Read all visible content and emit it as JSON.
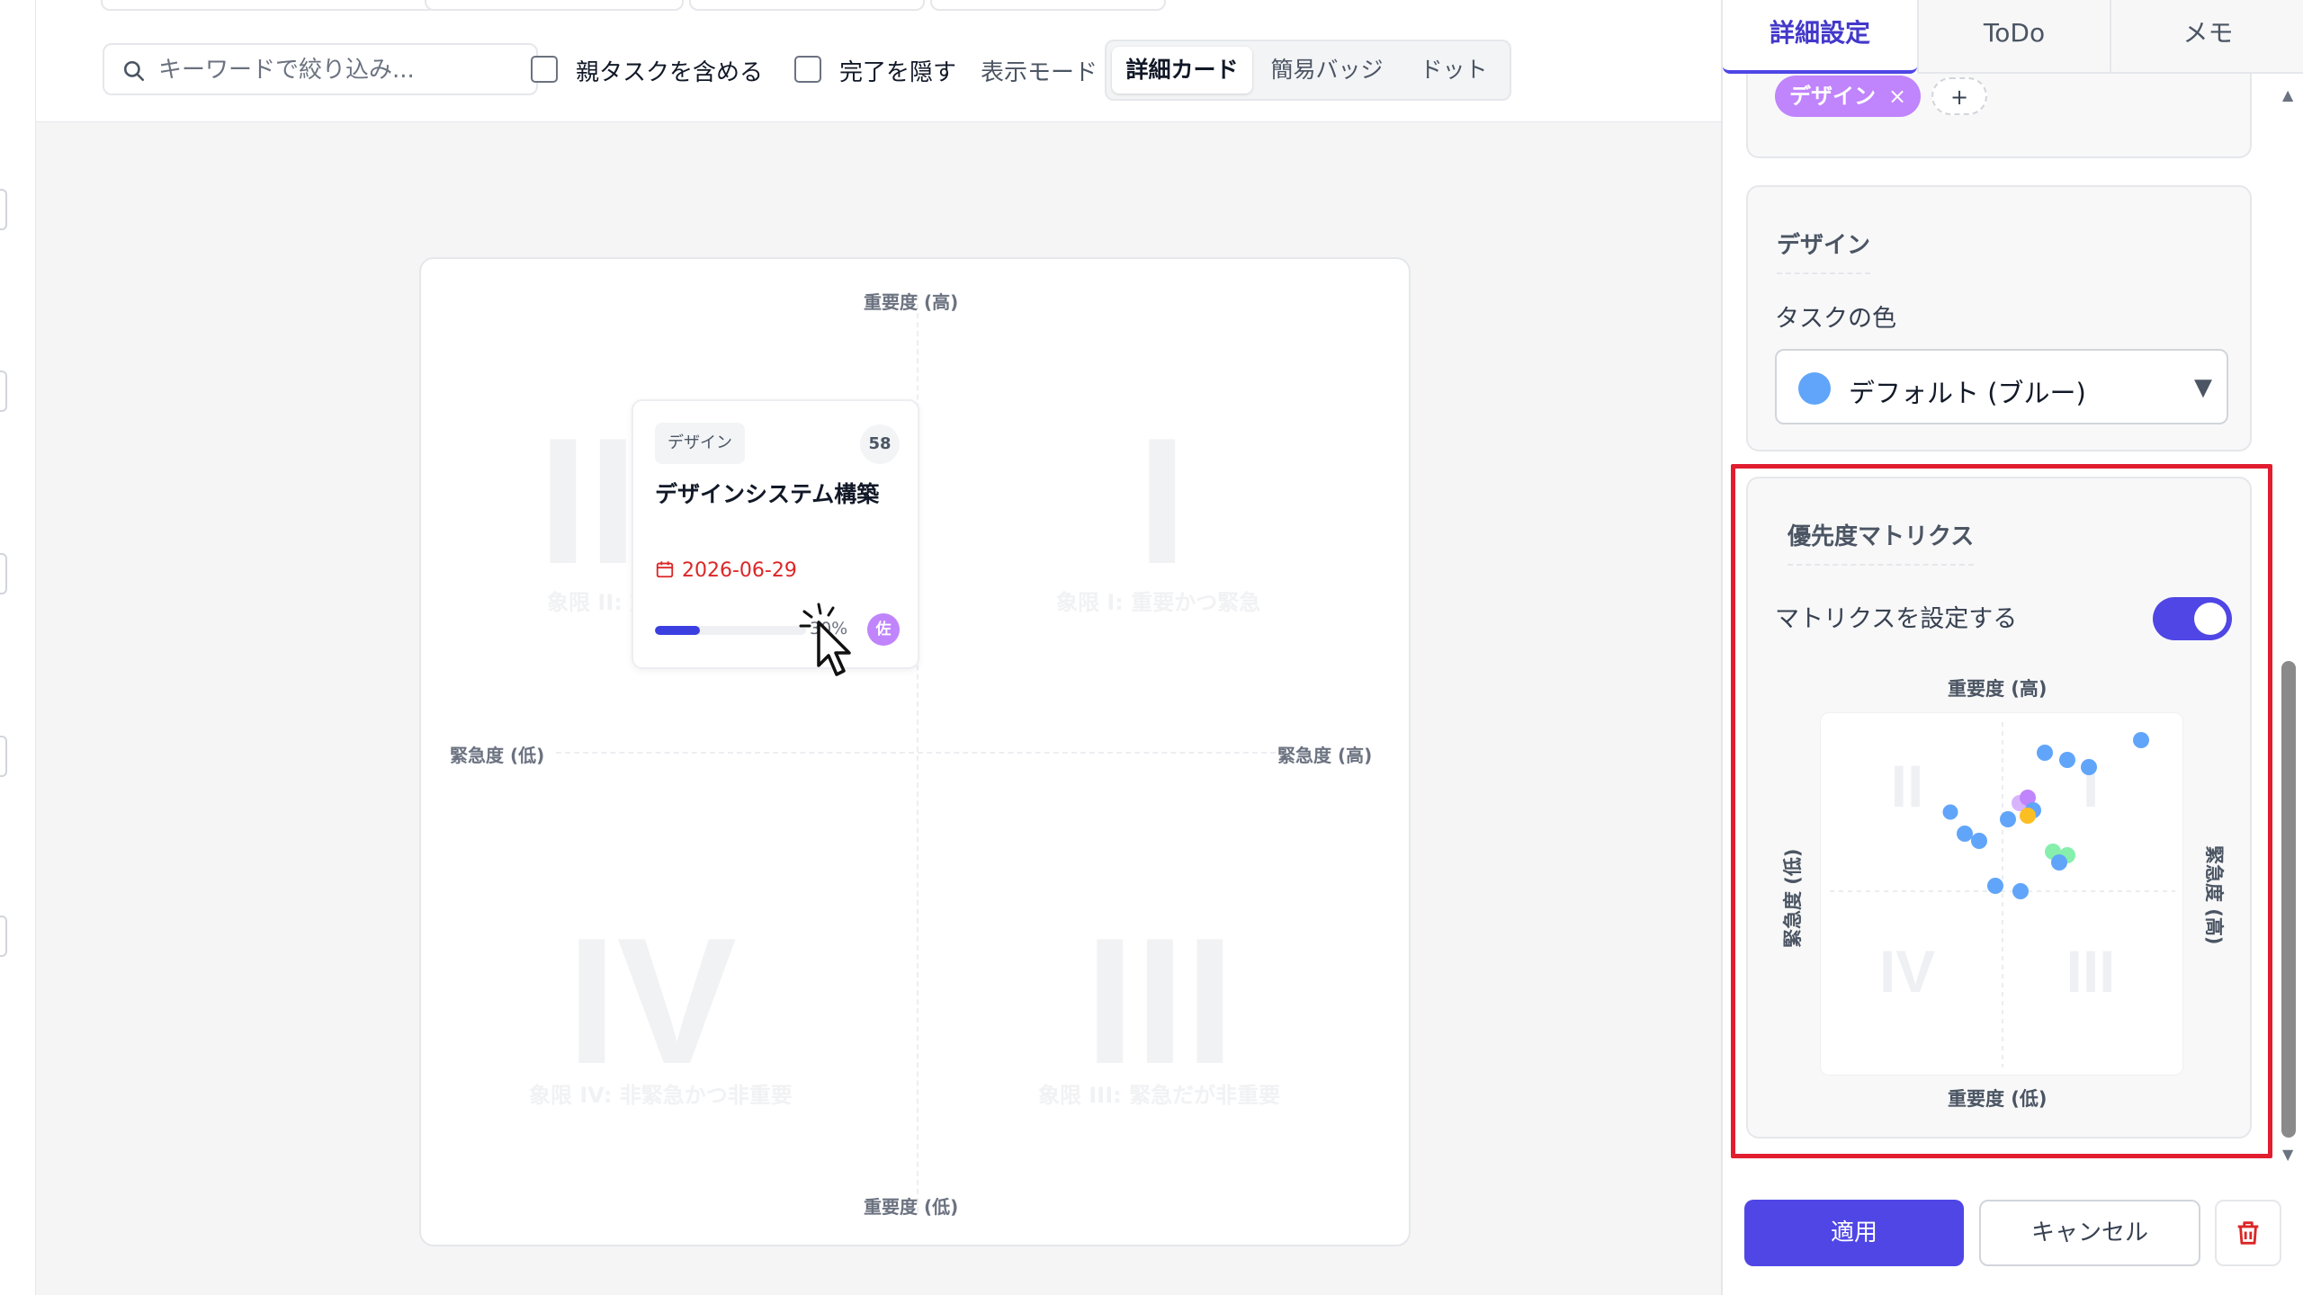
{
  "toolbar": {
    "search_placeholder": "キーワードで絞り込み...",
    "include_parent_label": "親タスクを含める",
    "hide_done_label": "完了を隠す",
    "view_mode_label": "表示モード",
    "view_modes": [
      "詳細カード",
      "簡易バッジ",
      "ドット"
    ],
    "active_view_mode": "詳細カード"
  },
  "matrix": {
    "axis_top": "重要度 (高)",
    "axis_bottom": "重要度 (低)",
    "axis_left": "緊急度 (低)",
    "axis_right": "緊急度 (高)",
    "quadrants": [
      {
        "roman": "I",
        "label": "象限 I: 重要かつ緊急"
      },
      {
        "roman": "II",
        "label": "象限 II: 重要だが非緊急"
      },
      {
        "roman": "III",
        "label": "象限 III: 緊急だが非重要"
      },
      {
        "roman": "IV",
        "label": "象限 IV: 非緊急かつ非重要"
      }
    ]
  },
  "card": {
    "tag": "デザイン",
    "count": "58",
    "title": "デザインシステム構築",
    "due_date": "2026-06-29",
    "progress_text": "30%",
    "progress": 0.3,
    "assignee_initial": "佐"
  },
  "panel": {
    "tabs": [
      "詳細設定",
      "ToDo",
      "メモ"
    ],
    "active_tab": "詳細設定",
    "chip_label": "デザイン",
    "chip_remove": "×",
    "add_chip": "+",
    "color_section_title": "デザイン",
    "task_color_label": "タスクの色",
    "task_color_value": "デフォルト (ブルー)",
    "task_color_swatch": "#60a5fa",
    "matrix_section_title": "優先度マトリクス",
    "matrix_toggle_label": "マトリクスを設定する",
    "matrix_toggle_on": true,
    "mini_axis_top": "重要度 (高)",
    "mini_axis_bottom": "重要度 (低)",
    "mini_axis_left": "緊急度 (低)",
    "mini_axis_right": "緊急度 (高)",
    "mini_quadrants": [
      "II",
      "I",
      "IV",
      "III"
    ],
    "apply_label": "適用",
    "cancel_label": "キャンセル"
  },
  "colors": {
    "accent": "#4f46e5",
    "highlight": "#e11d2f",
    "tag_purple": "#c084fc",
    "due_red": "#dc2626"
  }
}
